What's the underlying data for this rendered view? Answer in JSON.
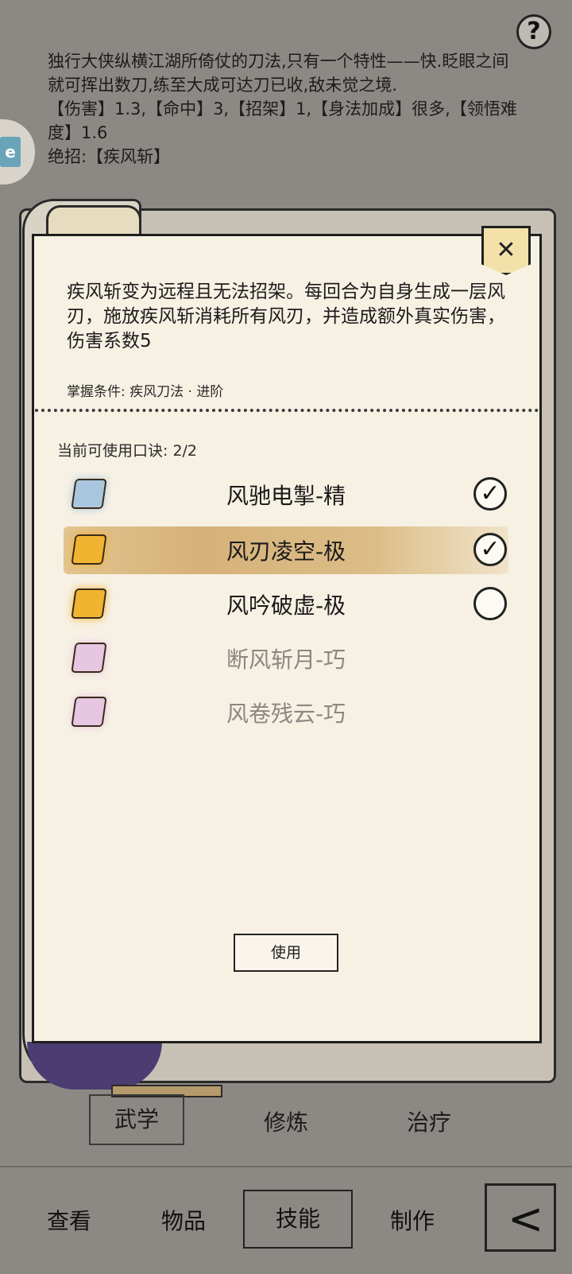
{
  "header": {
    "description": "独行大侠纵横江湖所倚仗的刀法,只有一个特性——快.眨眼之间就可挥出数刀,练至大成可达刀已收,敌未觉之境.",
    "stats": "【伤害】1.3,【命中】3,【招架】1,【身法加成】很多,【领悟难度】1.6",
    "ultimate": "绝招:【疾风斩】",
    "help_icon": "?"
  },
  "side_badge": {
    "label": "e"
  },
  "panel": {
    "close_icon": "✕",
    "skill_description": "疾风斩变为远程且无法招架。每回合为自身生成一层风刃，施放疾风斩消耗所有风刃，并造成额外真实伤害，伤害系数5",
    "condition": "掌握条件: 疾风刀法 · 进阶",
    "count_label": "当前可使用口诀: 2/2",
    "items": [
      {
        "name": "风驰电掣-精",
        "scroll_color": "#a9c6de",
        "checked": true,
        "highlight": false,
        "dim": false,
        "check_mark": "✓"
      },
      {
        "name": "风刃凌空-极",
        "scroll_color": "#f0b430",
        "checked": true,
        "highlight": true,
        "dim": false,
        "check_mark": "✓"
      },
      {
        "name": "风吟破虚-极",
        "scroll_color": "#f0b430",
        "checked": false,
        "highlight": false,
        "dim": false,
        "check_mark": ""
      },
      {
        "name": "断风斩月-巧",
        "scroll_color": "#e6c6e0",
        "checked": null,
        "highlight": false,
        "dim": true,
        "check_mark": ""
      },
      {
        "name": "风卷残云-巧",
        "scroll_color": "#e6c6e0",
        "checked": null,
        "highlight": false,
        "dim": true,
        "check_mark": ""
      }
    ],
    "use_button": "使用"
  },
  "subtabs": [
    "武学",
    "修炼",
    "治疗"
  ],
  "bottom_nav": [
    "查看",
    "物品",
    "技能",
    "制作"
  ],
  "back_icon": "<"
}
